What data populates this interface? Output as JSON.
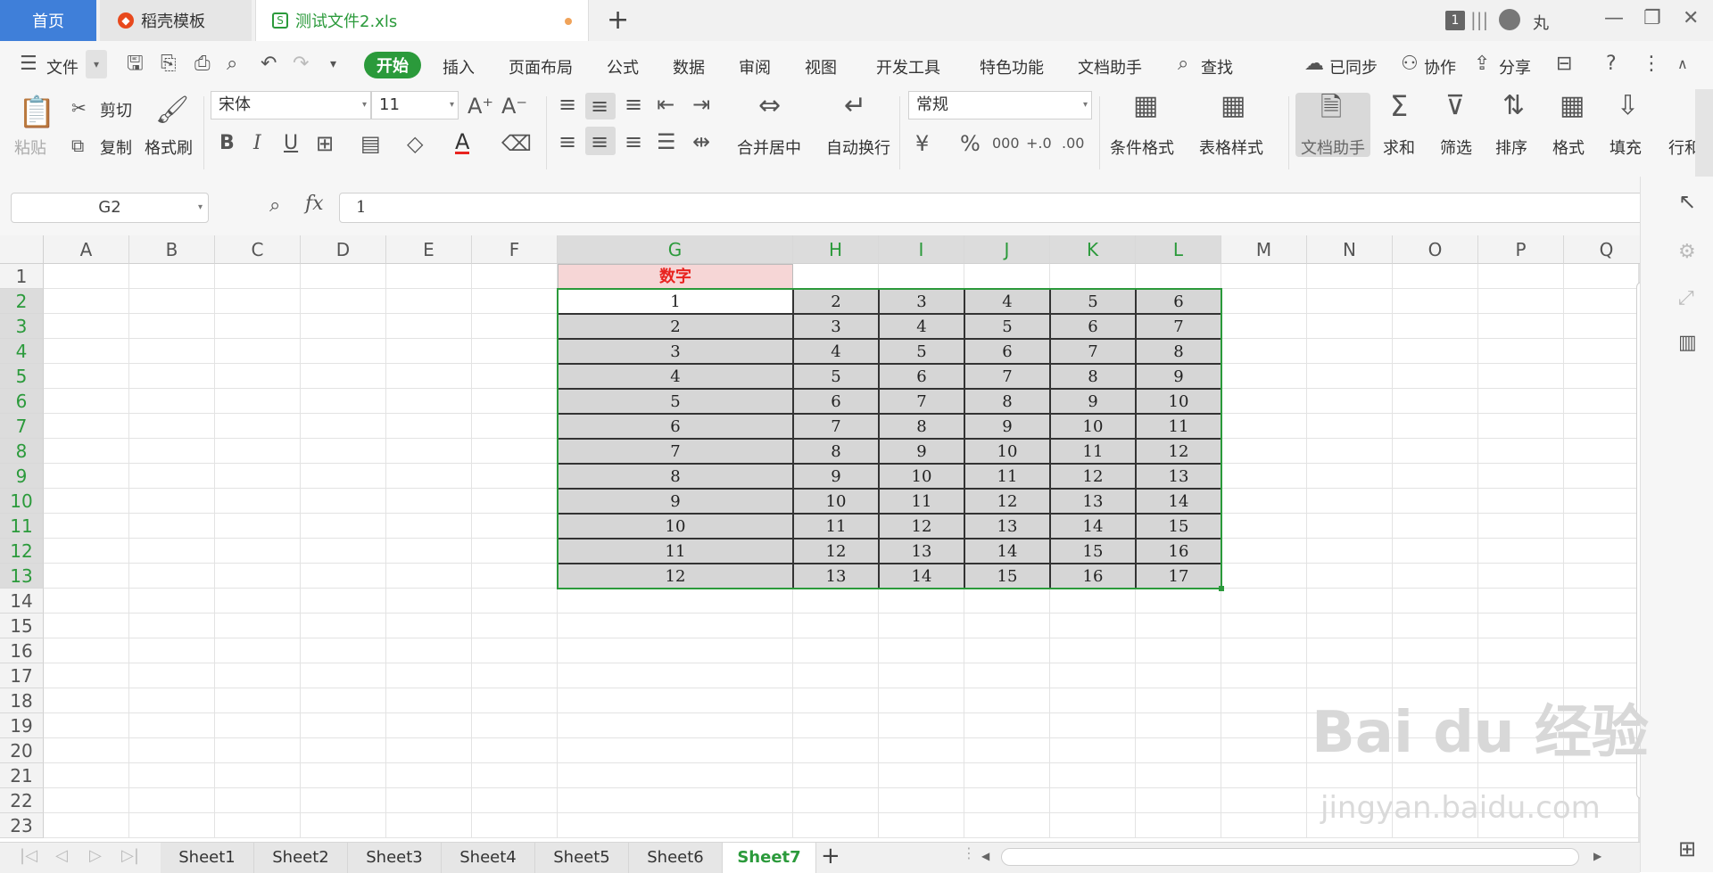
{
  "tabs": {
    "home": "首页",
    "daoke": "稻壳模板",
    "file": "测试文件2.xls",
    "add": "+"
  },
  "titlebar": {
    "badge": "1",
    "user": "丸"
  },
  "menu": {
    "file": "文件",
    "start": "开始",
    "items": [
      "插入",
      "页面布局",
      "公式",
      "数据",
      "审阅",
      "视图",
      "开发工具",
      "特色功能",
      "文档助手"
    ],
    "search": "查找",
    "synced": "已同步",
    "collab": "协作",
    "share": "分享"
  },
  "ribbon": {
    "paste": "粘贴",
    "cut": "剪切",
    "copy": "复制",
    "format_painter": "格式刷",
    "font_name": "宋体",
    "font_size": "11",
    "bold": "B",
    "italic": "I",
    "underline": "U",
    "font_color": "A",
    "merge": "合并居中",
    "wrap": "自动换行",
    "number_format": "常规",
    "cond_format": "条件格式",
    "table_style": "表格样式",
    "doc_assist": "文档助手",
    "sum": "求和",
    "filter": "筛选",
    "sort": "排序",
    "format": "格式",
    "fill": "填充",
    "rowcol": "行和"
  },
  "formula": {
    "cell_ref": "G2",
    "fx": "fx",
    "value": "1"
  },
  "grid": {
    "columns": [
      "A",
      "B",
      "C",
      "D",
      "E",
      "F",
      "G",
      "H",
      "I",
      "J",
      "K",
      "L",
      "M",
      "N",
      "O",
      "P",
      "Q"
    ],
    "selected_columns": [
      "G",
      "H",
      "I",
      "J",
      "K",
      "L"
    ],
    "rows": [
      "1",
      "2",
      "3",
      "4",
      "5",
      "6",
      "7",
      "8",
      "9",
      "10",
      "11",
      "12",
      "13",
      "14",
      "15",
      "16",
      "17",
      "18",
      "19",
      "20",
      "21",
      "22",
      "23"
    ],
    "selected_rows": [
      "2",
      "3",
      "4",
      "5",
      "6",
      "7",
      "8",
      "9",
      "10",
      "11",
      "12",
      "13"
    ],
    "header_cell": "数字",
    "table": [
      [
        "1",
        "2",
        "3",
        "4",
        "5",
        "6"
      ],
      [
        "2",
        "3",
        "4",
        "5",
        "6",
        "7"
      ],
      [
        "3",
        "4",
        "5",
        "6",
        "7",
        "8"
      ],
      [
        "4",
        "5",
        "6",
        "7",
        "8",
        "9"
      ],
      [
        "5",
        "6",
        "7",
        "8",
        "9",
        "10"
      ],
      [
        "6",
        "7",
        "8",
        "9",
        "10",
        "11"
      ],
      [
        "7",
        "8",
        "9",
        "10",
        "11",
        "12"
      ],
      [
        "8",
        "9",
        "10",
        "11",
        "12",
        "13"
      ],
      [
        "9",
        "10",
        "11",
        "12",
        "13",
        "14"
      ],
      [
        "10",
        "11",
        "12",
        "13",
        "14",
        "15"
      ],
      [
        "11",
        "12",
        "13",
        "14",
        "15",
        "16"
      ],
      [
        "12",
        "13",
        "14",
        "15",
        "16",
        "17"
      ]
    ]
  },
  "sheets": [
    "Sheet1",
    "Sheet2",
    "Sheet3",
    "Sheet4",
    "Sheet5",
    "Sheet6",
    "Sheet7"
  ],
  "active_sheet": "Sheet7",
  "watermark": {
    "brand": "Bai du 经验",
    "url": "jingyan.baidu.com"
  },
  "colors": {
    "accent_green": "#2b9a3b",
    "home_tab_blue": "#3f7fd9",
    "header_red": "#e8231f",
    "header_fill": "#f6d6d6",
    "selection_fill": "#d6d6d6"
  }
}
